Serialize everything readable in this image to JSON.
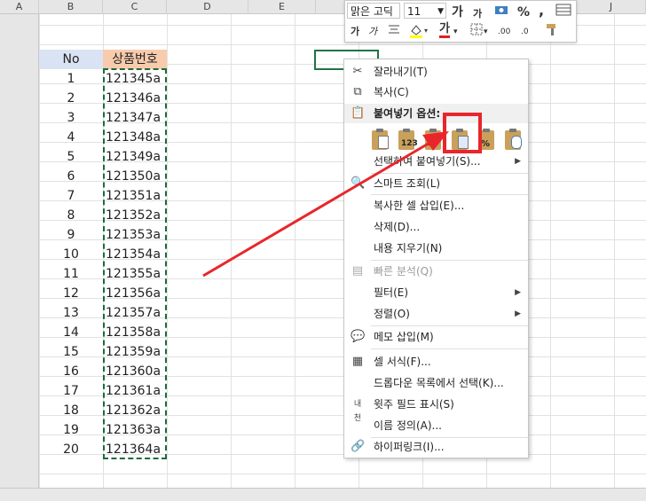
{
  "columns": [
    "A",
    "B",
    "C",
    "D",
    "E",
    "J"
  ],
  "table": {
    "header_no": "No",
    "header_code": "상품번호",
    "rows": [
      {
        "no": "1",
        "code": "121345a"
      },
      {
        "no": "2",
        "code": "121346a"
      },
      {
        "no": "3",
        "code": "121347a"
      },
      {
        "no": "4",
        "code": "121348a"
      },
      {
        "no": "5",
        "code": "121349a"
      },
      {
        "no": "6",
        "code": "121350a"
      },
      {
        "no": "7",
        "code": "121351a"
      },
      {
        "no": "8",
        "code": "121352a"
      },
      {
        "no": "9",
        "code": "121353a"
      },
      {
        "no": "10",
        "code": "121354a"
      },
      {
        "no": "11",
        "code": "121355a"
      },
      {
        "no": "12",
        "code": "121356a"
      },
      {
        "no": "13",
        "code": "121357a"
      },
      {
        "no": "14",
        "code": "121358a"
      },
      {
        "no": "15",
        "code": "121359a"
      },
      {
        "no": "16",
        "code": "121360a"
      },
      {
        "no": "17",
        "code": "121361a"
      },
      {
        "no": "18",
        "code": "121362a"
      },
      {
        "no": "19",
        "code": "121363a"
      },
      {
        "no": "20",
        "code": "121364a"
      }
    ]
  },
  "mini_toolbar": {
    "font_name": "맑은 고딕",
    "font_size": "11",
    "grow_font": "가",
    "shrink_font": "가",
    "percent": "%",
    "comma": ",",
    "bold": "가",
    "italic": "가",
    "font_color": "가",
    "inc_decimal": ".00",
    "dec_decimal": ".0"
  },
  "context_menu": {
    "cut": "잘라내기(T)",
    "copy": "복사(C)",
    "paste_options": "붙여넣기 옵션:",
    "paste_values_label": "123",
    "paste_formula_label": "fx",
    "paste_special": "선택하여 붙여넣기(S)...",
    "smart_lookup": "스마트 조회(L)",
    "insert_copied": "복사한 셀 삽입(E)...",
    "delete": "삭제(D)...",
    "clear_contents": "내용 지우기(N)",
    "quick_analysis": "빠른 분석(Q)",
    "filter": "필터(E)",
    "sort": "정렬(O)",
    "insert_comment": "메모 삽입(M)",
    "format_cells": "셀 서식(F)...",
    "pick_from_list": "드롭다운 목록에서 선택(K)...",
    "phonetic": "윗주 필드 표시(S)",
    "define_name": "이름 정의(A)...",
    "hyperlink": "하이퍼링크(I)..."
  },
  "colors": {
    "no_header_bg": "#dae3f3",
    "code_header_bg": "#f8cbad",
    "highlight": "#e8262b",
    "copy_border": "#1a6b3a"
  }
}
